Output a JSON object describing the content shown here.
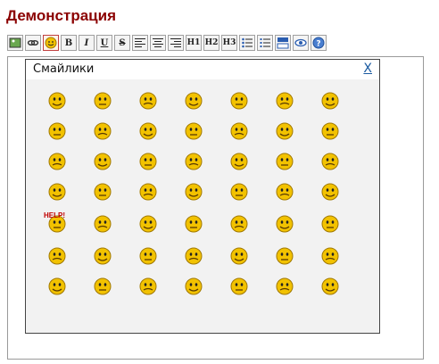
{
  "page": {
    "title": "Демонстрация"
  },
  "toolbar": {
    "buttons": [
      {
        "name": "image-button",
        "icon": "image-icon"
      },
      {
        "name": "link-button",
        "icon": "link-icon"
      },
      {
        "name": "smileys-button",
        "icon": "smiley-icon",
        "active": true
      },
      {
        "name": "bold-button",
        "label": "B"
      },
      {
        "name": "italic-button",
        "label": "I"
      },
      {
        "name": "underline-button",
        "label": "U"
      },
      {
        "name": "strike-button",
        "label": "S"
      },
      {
        "name": "align-left-button",
        "icon": "align-left-icon"
      },
      {
        "name": "align-center-button",
        "icon": "align-center-icon"
      },
      {
        "name": "align-right-button",
        "icon": "align-right-icon"
      },
      {
        "name": "h1-button",
        "label": "H1"
      },
      {
        "name": "h2-button",
        "label": "H2"
      },
      {
        "name": "h3-button",
        "label": "H3"
      },
      {
        "name": "bullet-list-button",
        "icon": "bullet-list-icon"
      },
      {
        "name": "numbered-list-button",
        "icon": "numbered-list-icon"
      },
      {
        "name": "block-button",
        "icon": "block-icon"
      },
      {
        "name": "preview-button",
        "icon": "eye-icon"
      },
      {
        "name": "help-button",
        "icon": "help-icon"
      }
    ]
  },
  "popup": {
    "title": "Смайлики",
    "close_label": "X",
    "help_text": "HELP!"
  },
  "colors": {
    "title": "#8b0000",
    "smiley": "#f2c200",
    "smiley_edge": "#a07800"
  }
}
